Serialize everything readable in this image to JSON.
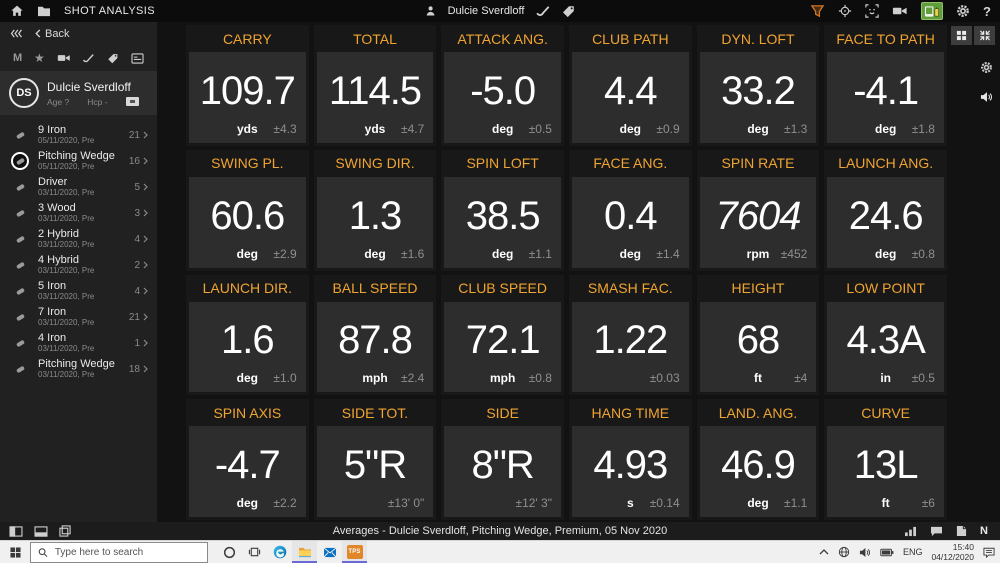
{
  "topbar": {
    "title": "SHOT ANALYSIS",
    "user": "Dulcie Sverdloff",
    "help_label": "?"
  },
  "sidebar": {
    "back_label": "Back",
    "filter_m": "M",
    "player": {
      "initials": "DS",
      "name": "Dulcie Sverdloff",
      "age": "Age ?",
      "hcp": "Hcp -"
    },
    "clubs": [
      {
        "name": "9 Iron",
        "date": "05/11/2020, Pre",
        "count": "21",
        "selected": false
      },
      {
        "name": "Pitching Wedge",
        "date": "05/11/2020, Pre",
        "count": "16",
        "selected": true
      },
      {
        "name": "Driver",
        "date": "03/11/2020, Pre",
        "count": "5",
        "selected": false
      },
      {
        "name": "3 Wood",
        "date": "03/11/2020, Pre",
        "count": "3",
        "selected": false
      },
      {
        "name": "2 Hybrid",
        "date": "03/11/2020, Pre",
        "count": "4",
        "selected": false
      },
      {
        "name": "4 Hybrid",
        "date": "03/11/2020, Pre",
        "count": "2",
        "selected": false
      },
      {
        "name": "5 Iron",
        "date": "03/11/2020, Pre",
        "count": "4",
        "selected": false
      },
      {
        "name": "7 Iron",
        "date": "03/11/2020, Pre",
        "count": "21",
        "selected": false
      },
      {
        "name": "4 Iron",
        "date": "03/11/2020, Pre",
        "count": "1",
        "selected": false
      },
      {
        "name": "Pitching Wedge",
        "date": "03/11/2020, Pre",
        "count": "18",
        "selected": false
      }
    ]
  },
  "tiles": [
    {
      "label": "CARRY",
      "value": "109.7",
      "unit": "yds",
      "tolerance": "±4.3"
    },
    {
      "label": "TOTAL",
      "value": "114.5",
      "unit": "yds",
      "tolerance": "±4.7"
    },
    {
      "label": "ATTACK ANG.",
      "value": "-5.0",
      "unit": "deg",
      "tolerance": "±0.5"
    },
    {
      "label": "CLUB PATH",
      "value": "4.4",
      "unit": "deg",
      "tolerance": "±0.9"
    },
    {
      "label": "DYN. LOFT",
      "value": "33.2",
      "unit": "deg",
      "tolerance": "±1.3"
    },
    {
      "label": "FACE TO PATH",
      "value": "-4.1",
      "unit": "deg",
      "tolerance": "±1.8"
    },
    {
      "label": "SWING PL.",
      "value": "60.6",
      "unit": "deg",
      "tolerance": "±2.9"
    },
    {
      "label": "SWING DIR.",
      "value": "1.3",
      "unit": "deg",
      "tolerance": "±1.6"
    },
    {
      "label": "SPIN LOFT",
      "value": "38.5",
      "unit": "deg",
      "tolerance": "±1.1"
    },
    {
      "label": "FACE ANG.",
      "value": "0.4",
      "unit": "deg",
      "tolerance": "±1.4"
    },
    {
      "label": "SPIN RATE",
      "value": "7604",
      "unit": "rpm",
      "tolerance": "±452",
      "italic": true
    },
    {
      "label": "LAUNCH ANG.",
      "value": "24.6",
      "unit": "deg",
      "tolerance": "±0.8"
    },
    {
      "label": "LAUNCH DIR.",
      "value": "1.6",
      "unit": "deg",
      "tolerance": "±1.0"
    },
    {
      "label": "BALL SPEED",
      "value": "87.8",
      "unit": "mph",
      "tolerance": "±2.4"
    },
    {
      "label": "CLUB SPEED",
      "value": "72.1",
      "unit": "mph",
      "tolerance": "±0.8"
    },
    {
      "label": "SMASH FAC.",
      "value": "1.22",
      "unit": "",
      "tolerance": "±0.03"
    },
    {
      "label": "HEIGHT",
      "value": "68",
      "unit": "ft",
      "tolerance": "±4"
    },
    {
      "label": "LOW POINT",
      "value": "4.3A",
      "unit": "in",
      "tolerance": "±0.5"
    },
    {
      "label": "SPIN AXIS",
      "value": "-4.7",
      "unit": "deg",
      "tolerance": "±2.2"
    },
    {
      "label": "SIDE TOT.",
      "value": "5\"R",
      "unit": "",
      "tolerance": "±13' 0\""
    },
    {
      "label": "SIDE",
      "value": "8\"R",
      "unit": "",
      "tolerance": "±12' 3\""
    },
    {
      "label": "HANG TIME",
      "value": "4.93",
      "unit": "s",
      "tolerance": "±0.14"
    },
    {
      "label": "LAND. ANG.",
      "value": "46.9",
      "unit": "deg",
      "tolerance": "±1.1"
    },
    {
      "label": "CURVE",
      "value": "13L",
      "unit": "ft",
      "tolerance": "±6"
    }
  ],
  "statusbar": {
    "text": "Averages - Dulcie Sverdloff, Pitching Wedge, Premium, 05 Nov 2020",
    "n_label": "N"
  },
  "taskbar": {
    "search_placeholder": "Type here to search",
    "tps_label": "TPS",
    "tray": {
      "language": "ENG",
      "time": "15:40",
      "date": "04/12/2020"
    }
  },
  "colors": {
    "accent_orange": "#F0A431",
    "device_green": "#5F9E3A",
    "taskbar_accent": "#6B69D6",
    "tps_orange": "#E2862A"
  }
}
